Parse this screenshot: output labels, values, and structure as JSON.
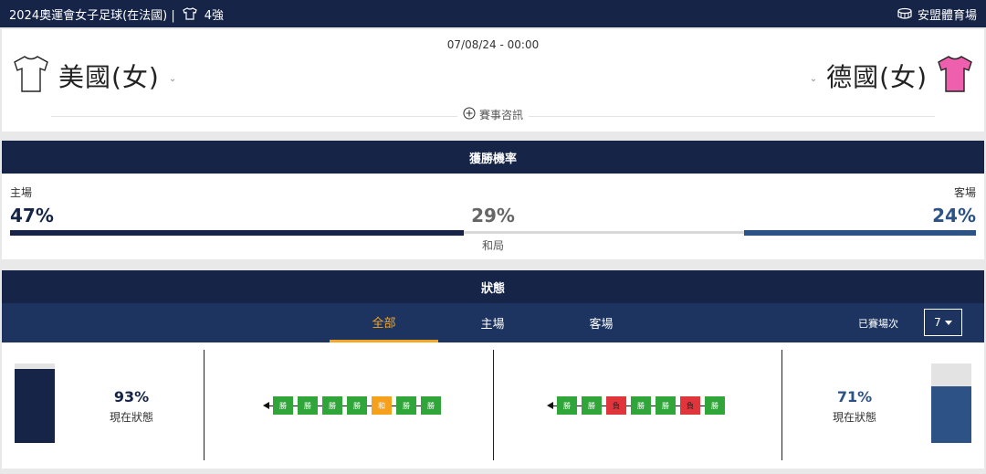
{
  "header": {
    "competition": "2024奧運會女子足球(在法國) |",
    "round": "4強",
    "venue": "安盟體育場"
  },
  "match": {
    "datetime": "07/08/24 - 00:00",
    "home_team": "美國(女)",
    "away_team": "德國(女)",
    "info_label": "賽事咨訊",
    "colors": {
      "home_kit": "#ffffff",
      "away_kit": "#ee5fae"
    }
  },
  "win_probability": {
    "title": "獲勝機率",
    "home_label": "主場",
    "home_pct": "47%",
    "home_value": 47,
    "draw_pct": "29%",
    "draw_value": 29,
    "draw_label": "和局",
    "away_label": "客場",
    "away_pct": "24%",
    "away_value": 24,
    "colors": {
      "home": "#162447",
      "draw": "#d9d9d9",
      "away": "#2c5286"
    }
  },
  "form": {
    "title": "狀態",
    "tabs": [
      "全部",
      "主場",
      "客場"
    ],
    "active_tab": "全部",
    "played_label": "已賽場次",
    "played_value": "7",
    "home": {
      "pct": "93%",
      "value": 93,
      "label": "現在狀態",
      "color": "#162447",
      "results": [
        {
          "code": "W",
          "label": "勝"
        },
        {
          "code": "W",
          "label": "勝"
        },
        {
          "code": "W",
          "label": "勝"
        },
        {
          "code": "W",
          "label": "勝"
        },
        {
          "code": "D",
          "label": "和"
        },
        {
          "code": "W",
          "label": "勝"
        },
        {
          "code": "W",
          "label": "勝"
        }
      ]
    },
    "away": {
      "pct": "71%",
      "value": 71,
      "label": "現在狀態",
      "color": "#2c5286",
      "results": [
        {
          "code": "W",
          "label": "勝"
        },
        {
          "code": "W",
          "label": "勝"
        },
        {
          "code": "L",
          "label": "負"
        },
        {
          "code": "W",
          "label": "勝"
        },
        {
          "code": "W",
          "label": "勝"
        },
        {
          "code": "L",
          "label": "負"
        },
        {
          "code": "W",
          "label": "勝"
        }
      ]
    }
  }
}
